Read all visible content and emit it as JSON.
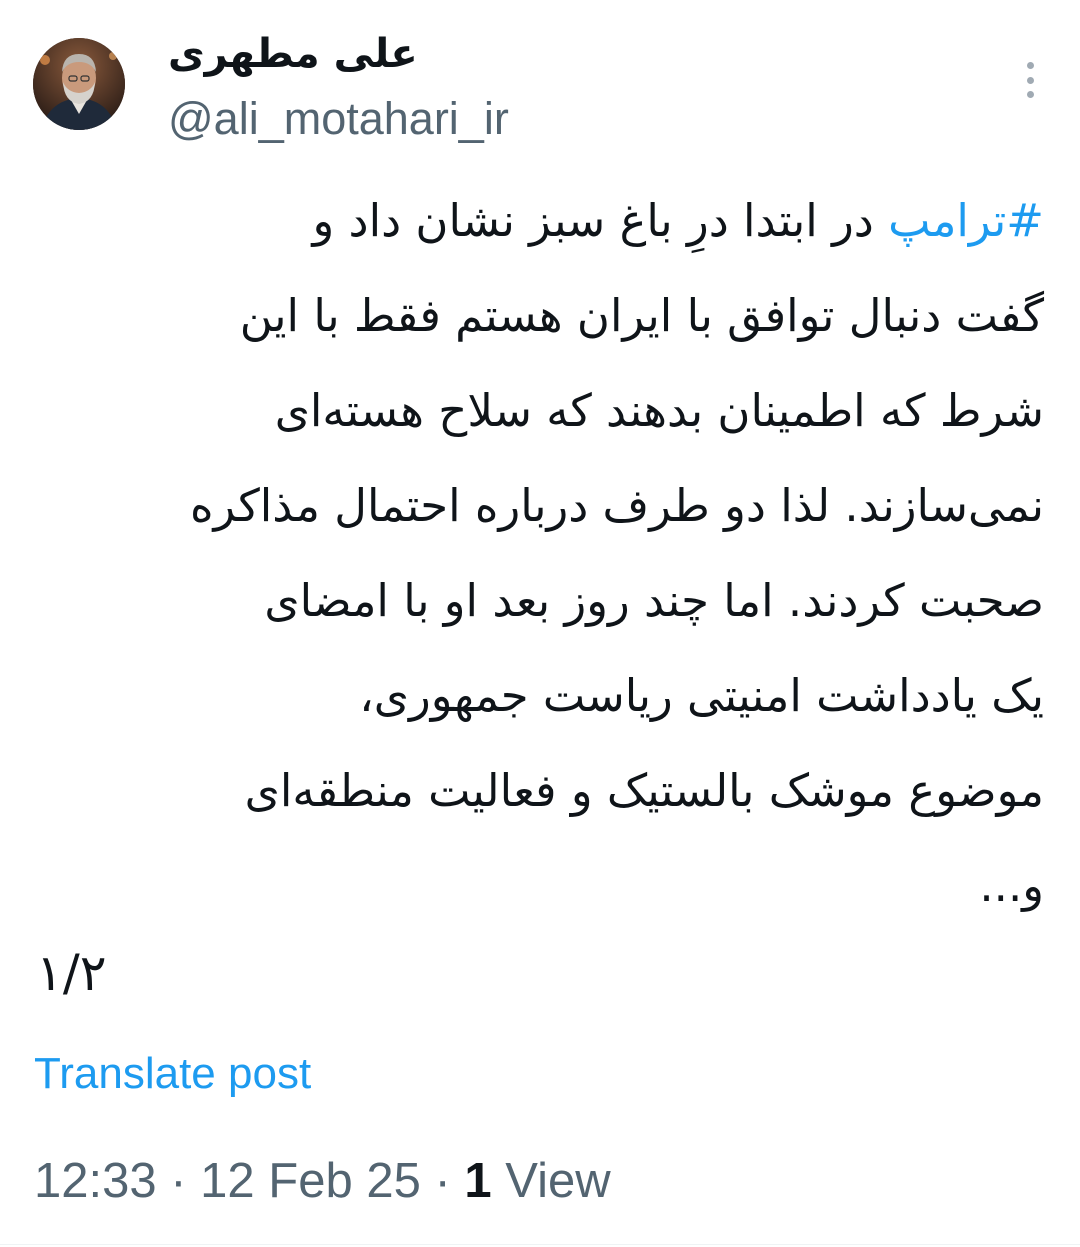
{
  "author": {
    "display_name": "علی مطهری",
    "handle": "@ali_motahari_ir",
    "avatar_icon": "profile-photo"
  },
  "tweet": {
    "hashtag": "#ترامپ",
    "lines": [
      " در ابتدا درِ باغ سبز نشان داد و",
      "گفت دنبال توافق با ایران هستم فقط با این",
      "شرط که اطمینان بدهند که سلاح هسته‌ای",
      "نمی‌سازند. لذا دو طرف درباره احتمال مذاکره",
      "صحبت کردند. اما چند روز بعد او با امضای",
      "یک یادداشت امنیتی ریاست جمهوری،",
      "موضوع موشک بالستیک و فعالیت منطقه‌ای",
      "و..."
    ],
    "thread_counter": "۱/۲"
  },
  "translate_label": "Translate post",
  "meta": {
    "time": "12:33",
    "separator": " · ",
    "date": "12 Feb 25",
    "views_count": "1",
    "views_label": " View"
  },
  "colors": {
    "link": "#1d9bf0",
    "text": "#0f1419",
    "secondary": "#536471"
  }
}
